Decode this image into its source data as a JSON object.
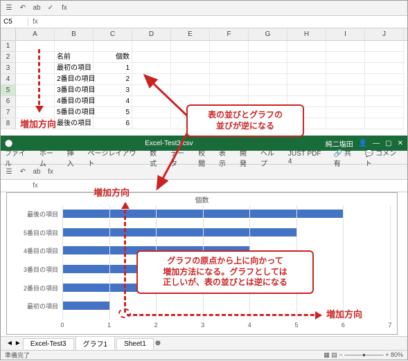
{
  "top": {
    "name_box": "C5",
    "headers": {
      "b": "名前",
      "c": "個数"
    },
    "rows": [
      {
        "n": 1,
        "b": "",
        "c": ""
      },
      {
        "n": 2,
        "b": "名前",
        "c": "個数"
      },
      {
        "n": 3,
        "b": "最初の項目",
        "c": "1"
      },
      {
        "n": 4,
        "b": "2番目の項目",
        "c": "2"
      },
      {
        "n": 5,
        "b": "3番目の項目",
        "c": "3"
      },
      {
        "n": 6,
        "b": "4番目の項目",
        "c": "4"
      },
      {
        "n": 7,
        "b": "5番目の項目",
        "c": "5"
      },
      {
        "n": 8,
        "b": "最後の項目",
        "c": "6"
      }
    ],
    "cols": [
      "A",
      "B",
      "C",
      "D",
      "E",
      "F",
      "G",
      "H",
      "I",
      "J"
    ],
    "label_increase": "増加方向",
    "callout1_l1": "表の並びとグラフの",
    "callout1_l2": "並びが逆になる"
  },
  "bottom": {
    "filename": "Excel-Test3.csv",
    "user": "純二塩田",
    "share": "共有",
    "comment": "コメント",
    "ribbon": [
      "ファイル",
      "ホーム",
      "挿入",
      "ページレイアウト",
      "数式",
      "データ",
      "校閲",
      "表示",
      "開発",
      "ヘルプ",
      "JUST PDF 4"
    ],
    "chart_title": "個数",
    "sheet_tabs": [
      "Excel-Test3",
      "グラフ1",
      "Sheet1"
    ],
    "active_tab": 1,
    "status": "準備完了",
    "zoom": "80%",
    "label_increase_v": "増加方向",
    "label_increase_h": "増加方向",
    "callout2_l1": "グラフの原点から上に向かって",
    "callout2_l2": "増加方法になる。グラフとしては",
    "callout2_l3": "正しいが、表の並びとは逆になる"
  },
  "chart_data": {
    "type": "bar",
    "title": "個数",
    "categories": [
      "最後の項目",
      "5番目の項目",
      "4番目の項目",
      "3番目の項目",
      "2番目の項目",
      "最初の項目"
    ],
    "values": [
      6,
      5,
      4,
      3,
      2,
      1
    ],
    "xlim": [
      0,
      7
    ],
    "x_ticks": [
      0,
      1,
      2,
      3,
      4,
      5,
      6,
      7
    ],
    "xlabel": "",
    "ylabel": ""
  }
}
